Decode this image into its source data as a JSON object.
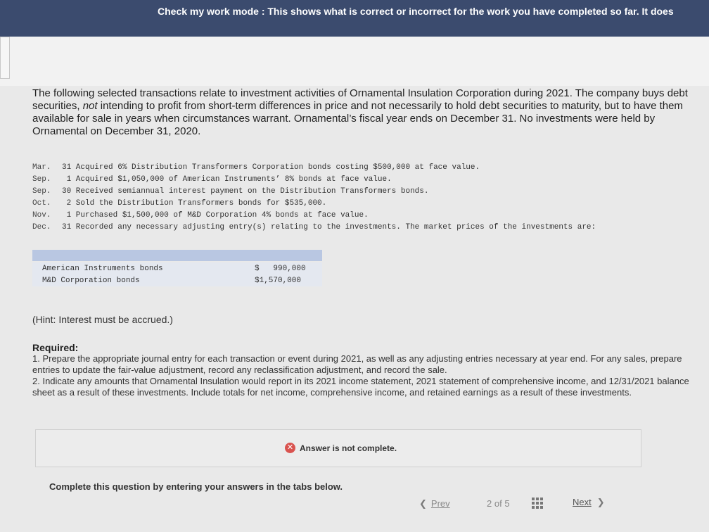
{
  "banner": {
    "text": "Check my work mode : This shows what is correct or incorrect for the work you have completed so far. It does"
  },
  "intro": {
    "part1": "The following selected transactions relate to investment activities of Ornamental Insulation Corporation during 2021. The company buys debt securities, ",
    "emphasis": "not",
    "part2": " intending to profit from short-term differences in price and not necessarily to hold debt securities to maturity, but to have them available for sale in years when circumstances warrant. Ornamental’s fiscal year ends on December 31. No investments were held by Ornamental on December 31, 2020."
  },
  "transactions": [
    {
      "month": "Mar.",
      "text": "31 Acquired 6% Distribution Transformers Corporation bonds costing $500,000 at face value."
    },
    {
      "month": "Sep.",
      "text": " 1 Acquired $1,050,000 of American Instruments’ 8% bonds at face value."
    },
    {
      "month": "Sep.",
      "text": "30 Received semiannual interest payment on the Distribution Transformers bonds."
    },
    {
      "month": "Oct.",
      "text": " 2 Sold the Distribution Transformers bonds for $535,000."
    },
    {
      "month": "Nov.",
      "text": " 1 Purchased $1,500,000 of M&D Corporation 4% bonds at face value."
    },
    {
      "month": "Dec.",
      "text": "31 Recorded any necessary adjusting entry(s) relating to the investments. The market prices of the investments are:"
    }
  ],
  "prices": [
    {
      "name": "American Instruments bonds",
      "value": "$   990,000"
    },
    {
      "name": "M&D Corporation bonds",
      "value": "$1,570,000"
    }
  ],
  "hint": "(Hint: Interest must be accrued.)",
  "required": {
    "title": "Required:",
    "item1": "1. Prepare the appropriate journal entry for each transaction or event during 2021, as well as any adjusting entries necessary at year end. For any sales, prepare entries to update the fair-value adjustment, record any reclassification adjustment, and record the sale.",
    "item2": "2. Indicate any amounts that Ornamental Insulation would report in its 2021 income statement, 2021 statement of comprehensive income, and 12/31/2021 balance sheet as a result of these investments. Include totals for net income, comprehensive income, and retained earnings as a result of these investments."
  },
  "answer_status": "Answer is not complete.",
  "complete_text": "Complete this question by entering your answers in the tabs below.",
  "nav": {
    "prev": "Prev",
    "page_current": "2",
    "page_of": "of",
    "page_total": "5",
    "next": "Next"
  }
}
